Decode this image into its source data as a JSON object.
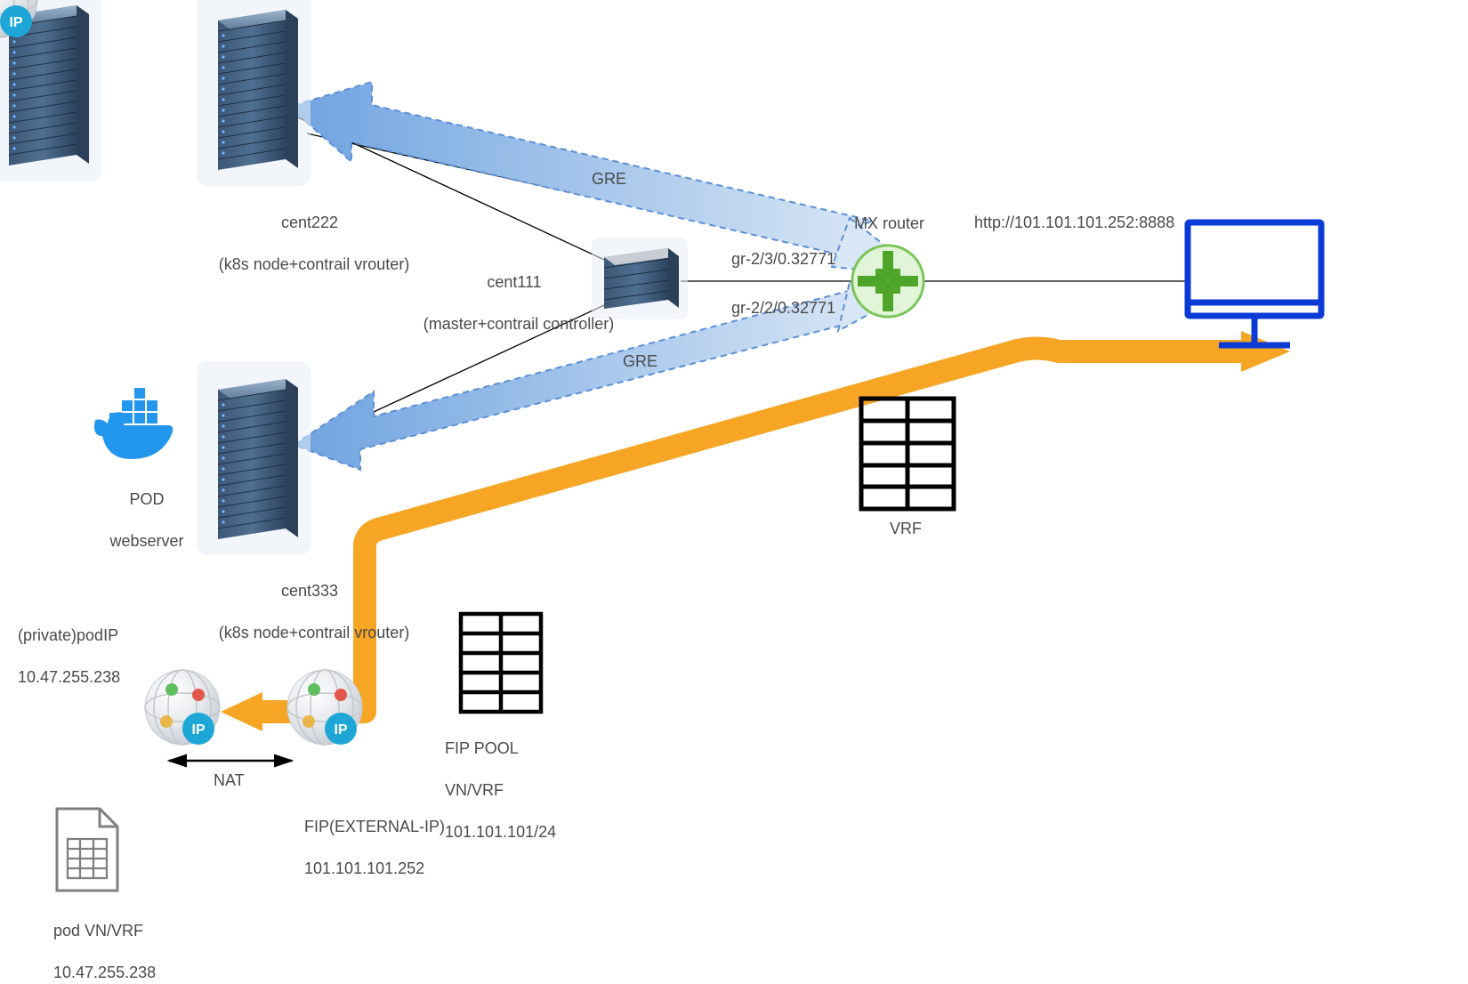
{
  "nodes": {
    "cent222": {
      "name": "cent222",
      "subtitle": "(k8s node+contrail vrouter)"
    },
    "cent111": {
      "name": "cent111",
      "subtitle": "(master+contrail controller)"
    },
    "cent333": {
      "name": "cent333",
      "subtitle": "(k8s node+contrail vrouter)"
    },
    "mx": {
      "name": "MX router"
    },
    "pod": {
      "line1": "POD",
      "line2": "webserver"
    }
  },
  "labels": {
    "gre1": "GRE",
    "gre2": "GRE",
    "if1": "gr-2/3/0.32771",
    "if2": "gr-2/2/0.32771",
    "vrf": "VRF",
    "url": "http://101.101.101.252:8888",
    "nat": "NAT",
    "fip_pool_l1": "FIP POOL",
    "fip_pool_l2": "VN/VRF",
    "fip_pool_l3": "101.101.101/24",
    "fip_l1": "FIP(EXTERNAL-IP)",
    "fip_l2": "101.101.101.252",
    "podip_l1": "(private)podIP",
    "podip_l2": "10.47.255.238",
    "podvrf_l1": "pod VN/VRF",
    "podvrf_l2": "10.47.255.238"
  }
}
